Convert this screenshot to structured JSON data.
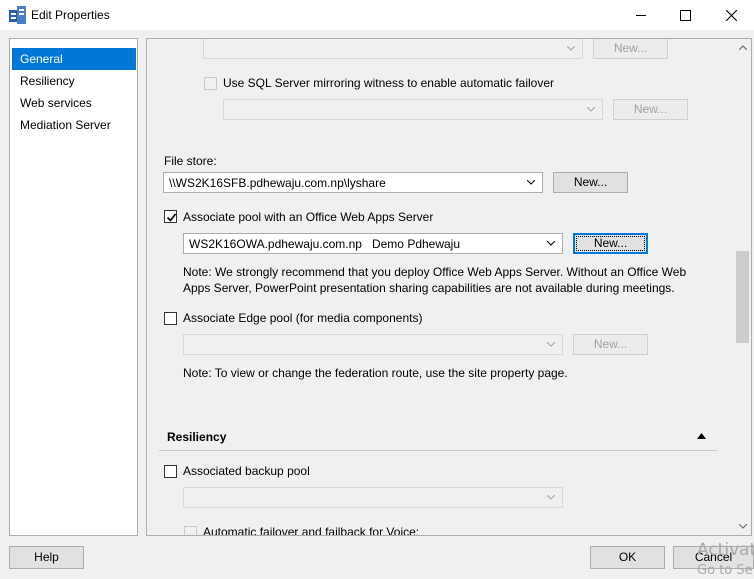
{
  "window": {
    "title": "Edit Properties",
    "icons": {
      "app": "server-icon",
      "minimize": "minimize-icon",
      "maximize": "maximize-icon",
      "close": "close-icon"
    }
  },
  "nav": {
    "items": [
      {
        "label": "General",
        "selected": true
      },
      {
        "label": "Resiliency",
        "selected": false
      },
      {
        "label": "Web services",
        "selected": false
      },
      {
        "label": "Mediation Server",
        "selected": false
      }
    ]
  },
  "content": {
    "top_combo": {
      "value": ""
    },
    "top_new_button": "New...",
    "mirroring": {
      "label": "Use SQL Server mirroring witness to enable automatic failover",
      "checked": false
    },
    "mirroring_combo": {
      "value": ""
    },
    "mirroring_new_button": "New...",
    "file_store": {
      "label": "File store:",
      "value": "\\\\WS2K16SFB.pdhewaju.com.np\\lyshare",
      "new_button": "New..."
    },
    "office_web_apps": {
      "label": "Associate pool with an Office Web Apps Server",
      "checked": true,
      "value": "WS2K16OWA.pdhewaju.com.np   Demo Pdhewaju",
      "new_button": "New...",
      "note": "Note: We strongly recommend that you deploy Office Web Apps Server. Without an Office Web Apps Server, PowerPoint presentation sharing capabilities are not available during meetings."
    },
    "edge_pool": {
      "label": "Associate Edge pool (for media components)",
      "checked": false,
      "value": "",
      "new_button": "New...",
      "note": "Note: To view or change the federation route, use the site property page."
    },
    "resiliency_section": {
      "title": "Resiliency",
      "backup_pool": {
        "label": "Associated backup pool",
        "checked": false,
        "value": ""
      },
      "failover": {
        "label": "Automatic failover and failback for Voice:",
        "checked": false
      }
    }
  },
  "footer": {
    "help": "Help",
    "ok": "OK",
    "cancel": "Cancel"
  },
  "watermark": {
    "line1": "Activat",
    "line2": "Go to Se"
  },
  "colors": {
    "accent": "#0078d7",
    "border": "#adadad",
    "background": "#f0f0f0"
  }
}
